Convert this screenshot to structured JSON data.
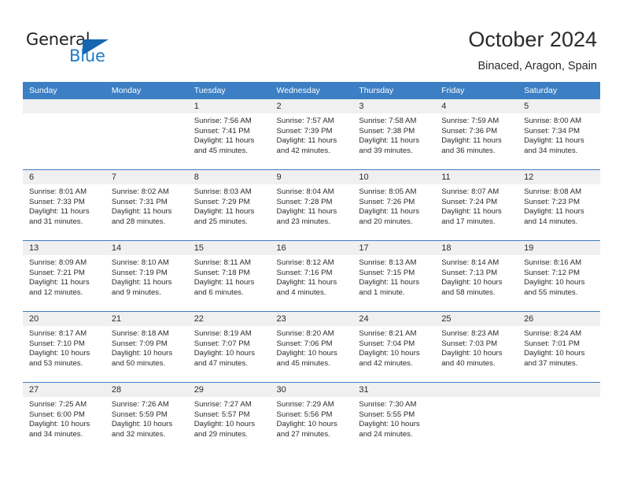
{
  "brand": {
    "name_top": "General",
    "name_bottom": "Blue",
    "flag_icon": "blue-triangle-flag",
    "color_primary": "#1565b0",
    "color_text": "#231f20"
  },
  "header": {
    "title": "October 2024",
    "location": "Binaced, Aragon, Spain"
  },
  "theme": {
    "header_row_bg": "#3c7fc4",
    "daynum_band_bg": "#f0f0f0",
    "row_separator": "#3c7fc4",
    "text": "#2b2b2b"
  },
  "calendar": {
    "weekday_headers": [
      "Sunday",
      "Monday",
      "Tuesday",
      "Wednesday",
      "Thursday",
      "Friday",
      "Saturday"
    ],
    "weeks": [
      [
        {
          "day": "",
          "empty": true
        },
        {
          "day": "",
          "empty": true
        },
        {
          "day": "1",
          "sunrise": "Sunrise: 7:56 AM",
          "sunset": "Sunset: 7:41 PM",
          "daylight_1": "Daylight: 11 hours",
          "daylight_2": "and 45 minutes."
        },
        {
          "day": "2",
          "sunrise": "Sunrise: 7:57 AM",
          "sunset": "Sunset: 7:39 PM",
          "daylight_1": "Daylight: 11 hours",
          "daylight_2": "and 42 minutes."
        },
        {
          "day": "3",
          "sunrise": "Sunrise: 7:58 AM",
          "sunset": "Sunset: 7:38 PM",
          "daylight_1": "Daylight: 11 hours",
          "daylight_2": "and 39 minutes."
        },
        {
          "day": "4",
          "sunrise": "Sunrise: 7:59 AM",
          "sunset": "Sunset: 7:36 PM",
          "daylight_1": "Daylight: 11 hours",
          "daylight_2": "and 36 minutes."
        },
        {
          "day": "5",
          "sunrise": "Sunrise: 8:00 AM",
          "sunset": "Sunset: 7:34 PM",
          "daylight_1": "Daylight: 11 hours",
          "daylight_2": "and 34 minutes."
        }
      ],
      [
        {
          "day": "6",
          "sunrise": "Sunrise: 8:01 AM",
          "sunset": "Sunset: 7:33 PM",
          "daylight_1": "Daylight: 11 hours",
          "daylight_2": "and 31 minutes."
        },
        {
          "day": "7",
          "sunrise": "Sunrise: 8:02 AM",
          "sunset": "Sunset: 7:31 PM",
          "daylight_1": "Daylight: 11 hours",
          "daylight_2": "and 28 minutes."
        },
        {
          "day": "8",
          "sunrise": "Sunrise: 8:03 AM",
          "sunset": "Sunset: 7:29 PM",
          "daylight_1": "Daylight: 11 hours",
          "daylight_2": "and 25 minutes."
        },
        {
          "day": "9",
          "sunrise": "Sunrise: 8:04 AM",
          "sunset": "Sunset: 7:28 PM",
          "daylight_1": "Daylight: 11 hours",
          "daylight_2": "and 23 minutes."
        },
        {
          "day": "10",
          "sunrise": "Sunrise: 8:05 AM",
          "sunset": "Sunset: 7:26 PM",
          "daylight_1": "Daylight: 11 hours",
          "daylight_2": "and 20 minutes."
        },
        {
          "day": "11",
          "sunrise": "Sunrise: 8:07 AM",
          "sunset": "Sunset: 7:24 PM",
          "daylight_1": "Daylight: 11 hours",
          "daylight_2": "and 17 minutes."
        },
        {
          "day": "12",
          "sunrise": "Sunrise: 8:08 AM",
          "sunset": "Sunset: 7:23 PM",
          "daylight_1": "Daylight: 11 hours",
          "daylight_2": "and 14 minutes."
        }
      ],
      [
        {
          "day": "13",
          "sunrise": "Sunrise: 8:09 AM",
          "sunset": "Sunset: 7:21 PM",
          "daylight_1": "Daylight: 11 hours",
          "daylight_2": "and 12 minutes."
        },
        {
          "day": "14",
          "sunrise": "Sunrise: 8:10 AM",
          "sunset": "Sunset: 7:19 PM",
          "daylight_1": "Daylight: 11 hours",
          "daylight_2": "and 9 minutes."
        },
        {
          "day": "15",
          "sunrise": "Sunrise: 8:11 AM",
          "sunset": "Sunset: 7:18 PM",
          "daylight_1": "Daylight: 11 hours",
          "daylight_2": "and 6 minutes."
        },
        {
          "day": "16",
          "sunrise": "Sunrise: 8:12 AM",
          "sunset": "Sunset: 7:16 PM",
          "daylight_1": "Daylight: 11 hours",
          "daylight_2": "and 4 minutes."
        },
        {
          "day": "17",
          "sunrise": "Sunrise: 8:13 AM",
          "sunset": "Sunset: 7:15 PM",
          "daylight_1": "Daylight: 11 hours",
          "daylight_2": "and 1 minute."
        },
        {
          "day": "18",
          "sunrise": "Sunrise: 8:14 AM",
          "sunset": "Sunset: 7:13 PM",
          "daylight_1": "Daylight: 10 hours",
          "daylight_2": "and 58 minutes."
        },
        {
          "day": "19",
          "sunrise": "Sunrise: 8:16 AM",
          "sunset": "Sunset: 7:12 PM",
          "daylight_1": "Daylight: 10 hours",
          "daylight_2": "and 55 minutes."
        }
      ],
      [
        {
          "day": "20",
          "sunrise": "Sunrise: 8:17 AM",
          "sunset": "Sunset: 7:10 PM",
          "daylight_1": "Daylight: 10 hours",
          "daylight_2": "and 53 minutes."
        },
        {
          "day": "21",
          "sunrise": "Sunrise: 8:18 AM",
          "sunset": "Sunset: 7:09 PM",
          "daylight_1": "Daylight: 10 hours",
          "daylight_2": "and 50 minutes."
        },
        {
          "day": "22",
          "sunrise": "Sunrise: 8:19 AM",
          "sunset": "Sunset: 7:07 PM",
          "daylight_1": "Daylight: 10 hours",
          "daylight_2": "and 47 minutes."
        },
        {
          "day": "23",
          "sunrise": "Sunrise: 8:20 AM",
          "sunset": "Sunset: 7:06 PM",
          "daylight_1": "Daylight: 10 hours",
          "daylight_2": "and 45 minutes."
        },
        {
          "day": "24",
          "sunrise": "Sunrise: 8:21 AM",
          "sunset": "Sunset: 7:04 PM",
          "daylight_1": "Daylight: 10 hours",
          "daylight_2": "and 42 minutes."
        },
        {
          "day": "25",
          "sunrise": "Sunrise: 8:23 AM",
          "sunset": "Sunset: 7:03 PM",
          "daylight_1": "Daylight: 10 hours",
          "daylight_2": "and 40 minutes."
        },
        {
          "day": "26",
          "sunrise": "Sunrise: 8:24 AM",
          "sunset": "Sunset: 7:01 PM",
          "daylight_1": "Daylight: 10 hours",
          "daylight_2": "and 37 minutes."
        }
      ],
      [
        {
          "day": "27",
          "sunrise": "Sunrise: 7:25 AM",
          "sunset": "Sunset: 6:00 PM",
          "daylight_1": "Daylight: 10 hours",
          "daylight_2": "and 34 minutes."
        },
        {
          "day": "28",
          "sunrise": "Sunrise: 7:26 AM",
          "sunset": "Sunset: 5:59 PM",
          "daylight_1": "Daylight: 10 hours",
          "daylight_2": "and 32 minutes."
        },
        {
          "day": "29",
          "sunrise": "Sunrise: 7:27 AM",
          "sunset": "Sunset: 5:57 PM",
          "daylight_1": "Daylight: 10 hours",
          "daylight_2": "and 29 minutes."
        },
        {
          "day": "30",
          "sunrise": "Sunrise: 7:29 AM",
          "sunset": "Sunset: 5:56 PM",
          "daylight_1": "Daylight: 10 hours",
          "daylight_2": "and 27 minutes."
        },
        {
          "day": "31",
          "sunrise": "Sunrise: 7:30 AM",
          "sunset": "Sunset: 5:55 PM",
          "daylight_1": "Daylight: 10 hours",
          "daylight_2": "and 24 minutes."
        },
        {
          "day": "",
          "empty": true
        },
        {
          "day": "",
          "empty": true
        }
      ]
    ]
  }
}
